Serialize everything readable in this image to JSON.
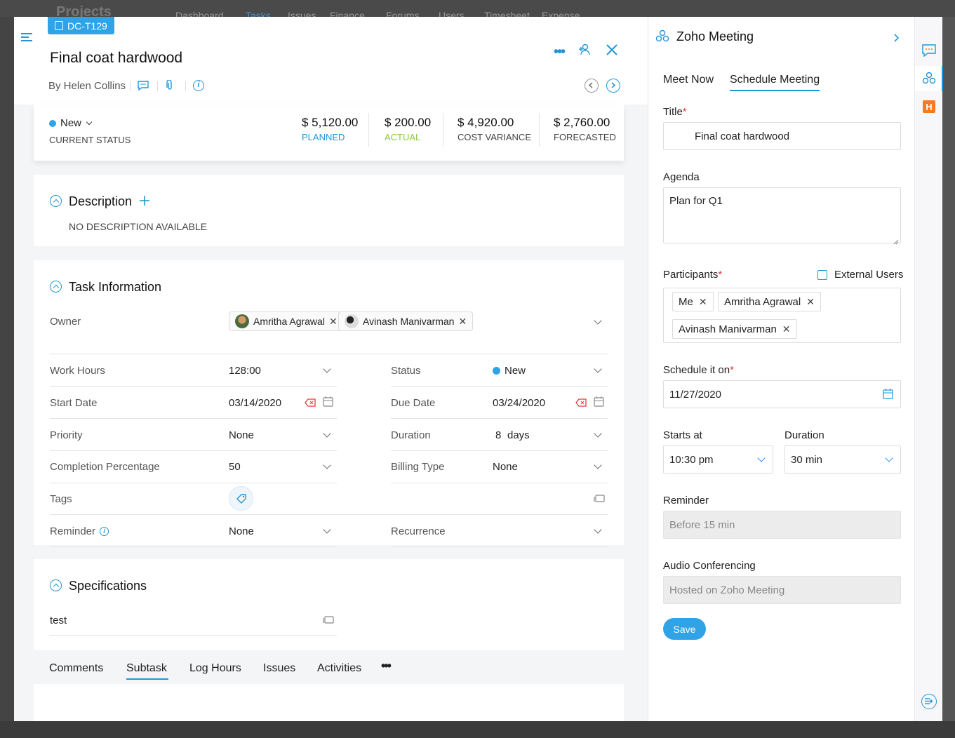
{
  "header": {
    "task_id": "DC-T129",
    "title": "Final coat hardwood",
    "author": "By Helen Collins"
  },
  "summary": {
    "status": "New",
    "status_label": "CURRENT STATUS",
    "planned": "$ 5,120.00",
    "planned_label": "PLANNED",
    "actual": "$ 200.00",
    "actual_label": "ACTUAL",
    "cost_variance": "$ 4,920.00",
    "cost_variance_label": "COST VARIANCE",
    "forecasted": "$ 2,760.00",
    "forecasted_label": "FORECASTED"
  },
  "description": {
    "heading": "Description",
    "empty_text": "NO DESCRIPTION AVAILABLE"
  },
  "task_info": {
    "heading": "Task Information",
    "owner_label": "Owner",
    "owners": [
      "Amritha Agrawal",
      "Avinash Manivarman"
    ],
    "work_hours_label": "Work Hours",
    "work_hours": "128:00",
    "status_label": "Status",
    "status": "New",
    "start_date_label": "Start Date",
    "start_date": "03/14/2020",
    "due_date_label": "Due Date",
    "due_date": "03/24/2020",
    "priority_label": "Priority",
    "priority": "None",
    "duration_label": "Duration",
    "duration_value": "8",
    "duration_unit": "days",
    "completion_label": "Completion Percentage",
    "completion": "50",
    "billing_label": "Billing Type",
    "billing": "None",
    "tags_label": "Tags",
    "reminder_label": "Reminder",
    "reminder": "None",
    "recurrence_label": "Recurrence"
  },
  "specifications": {
    "heading": "Specifications",
    "value": "test"
  },
  "bottom_tabs": [
    "Comments",
    "Subtask",
    "Log Hours",
    "Issues",
    "Activities"
  ],
  "meeting": {
    "app_title": "Zoho Meeting",
    "tab_meet_now": "Meet Now",
    "tab_schedule": "Schedule Meeting",
    "title_label": "Title",
    "title_value": "Final coat hardwood",
    "agenda_label": "Agenda",
    "agenda_value": "Plan for Q1",
    "participants_label": "Participants",
    "external_users_label": "External Users",
    "participants": [
      "Me",
      "Amritha Agrawal",
      "Avinash Manivarman"
    ],
    "schedule_label": "Schedule it on",
    "schedule_value": "11/27/2020",
    "starts_label": "Starts at",
    "starts_value": "10:30 pm",
    "duration_label": "Duration",
    "duration_value": "30 min",
    "reminder_label": "Reminder",
    "reminder_value": "Before 15 min",
    "audio_label": "Audio Conferencing",
    "audio_value": "Hosted on Zoho Meeting",
    "save_label": "Save",
    "required_mark": "*"
  },
  "background": {
    "app_name": "Projects",
    "nav": [
      "Dashboard",
      "Tasks",
      "Issues",
      "Finance",
      "Forums",
      "Users",
      "Timesheet",
      "Expense"
    ]
  },
  "colors": {
    "accent": "#2196d9",
    "status_dot": "#2fa3e6",
    "actual_green": "#8dc63f",
    "required_red": "#e53935",
    "rail_badge": "#f47b20"
  }
}
